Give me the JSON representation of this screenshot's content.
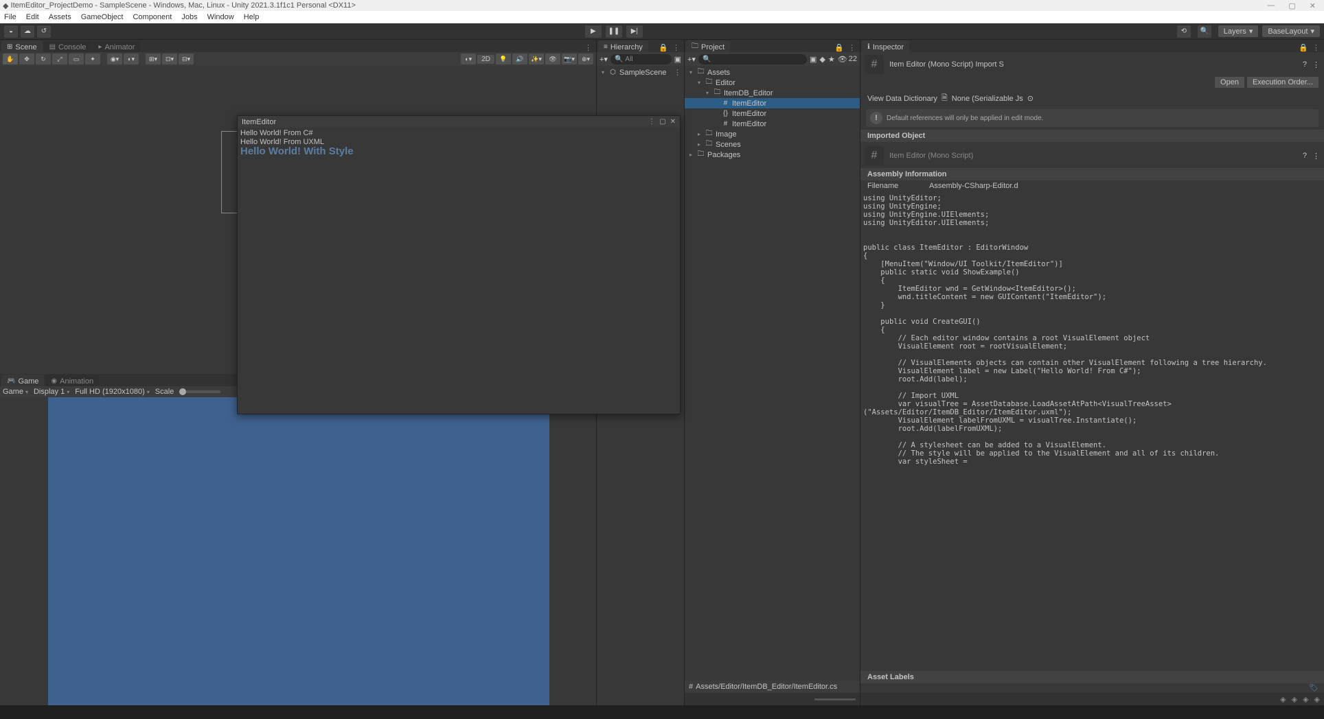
{
  "titlebar": {
    "text": "ItemEditor_ProjectDemo - SampleScene - Windows, Mac, Linux - Unity 2021.3.1f1c1 Personal <DX11>"
  },
  "menubar": [
    "File",
    "Edit",
    "Assets",
    "GameObject",
    "Component",
    "Jobs",
    "Window",
    "Help"
  ],
  "top_right": {
    "layers": "Layers",
    "layout": "BaseLayout"
  },
  "tabs": {
    "scene": "Scene",
    "console": "Console",
    "animator": "Animator",
    "game": "Game",
    "animation": "Animation",
    "hierarchy": "Hierarchy",
    "project": "Project",
    "inspector": "Inspector"
  },
  "scene_toolbar": {
    "mode2d": "2D"
  },
  "hierarchy": {
    "search_placeholder": "All",
    "root": "SampleScene"
  },
  "project": {
    "search_placeholder": "",
    "hidden_count": "22",
    "tree": [
      {
        "label": "Assets",
        "depth": 0,
        "icon": "▾",
        "type": "folder"
      },
      {
        "label": "Editor",
        "depth": 1,
        "icon": "▾",
        "type": "folder"
      },
      {
        "label": "ItemDB_Editor",
        "depth": 2,
        "icon": "▾",
        "type": "folder"
      },
      {
        "label": "ItemEditor",
        "depth": 3,
        "icon": "#",
        "type": "cs",
        "sel": true
      },
      {
        "label": "ItemEditor",
        "depth": 3,
        "icon": "{}",
        "type": "uss"
      },
      {
        "label": "ItemEditor",
        "depth": 3,
        "icon": "#",
        "type": "uxml"
      },
      {
        "label": "Image",
        "depth": 1,
        "icon": "▸",
        "type": "folder"
      },
      {
        "label": "Scenes",
        "depth": 1,
        "icon": "▸",
        "type": "folder"
      },
      {
        "label": "Packages",
        "depth": 0,
        "icon": "▸",
        "type": "folder"
      }
    ],
    "footer_path": "Assets/Editor/ItemDB_Editor/ItemEditor.cs"
  },
  "float_window": {
    "title": "ItemEditor",
    "line1": "Hello World! From C#",
    "line2": "Hello World! From UXML",
    "line3": "Hello World! With Style"
  },
  "game_toolbar": {
    "target": "Game",
    "display": "Display 1",
    "resolution": "Full HD (1920x1080)",
    "scale_label": "Scale"
  },
  "inspector": {
    "title": "Item Editor (Mono Script) Import S",
    "open_btn": "Open",
    "exec_btn": "Execution Order...",
    "view_dict": "View Data Dictionary",
    "ser_label": "None (Serializable Js",
    "warn": "Default references will only be applied in edit mode.",
    "imported": "Imported Object",
    "obj_title": "Item Editor (Mono Script)",
    "asm_header": "Assembly Information",
    "filename_k": "Filename",
    "filename_v": "Assembly-CSharp-Editor.d",
    "code": "using UnityEditor;\nusing UnityEngine;\nusing UnityEngine.UIElements;\nusing UnityEditor.UIElements;\n\n\npublic class ItemEditor : EditorWindow\n{\n    [MenuItem(\"Window/UI Toolkit/ItemEditor\")]\n    public static void ShowExample()\n    {\n        ItemEditor wnd = GetWindow<ItemEditor>();\n        wnd.titleContent = new GUIContent(\"ItemEditor\");\n    }\n\n    public void CreateGUI()\n    {\n        // Each editor window contains a root VisualElement object\n        VisualElement root = rootVisualElement;\n\n        // VisualElements objects can contain other VisualElement following a tree hierarchy.\n        VisualElement label = new Label(\"Hello World! From C#\");\n        root.Add(label);\n\n        // Import UXML\n        var visualTree = AssetDatabase.LoadAssetAtPath<VisualTreeAsset>(\"Assets/Editor/ItemDB_Editor/ItemEditor.uxml\");\n        VisualElement labelFromUXML = visualTree.Instantiate();\n        root.Add(labelFromUXML);\n\n        // A stylesheet can be added to a VisualElement.\n        // The style will be applied to the VisualElement and all of its children.\n        var styleSheet =",
    "asset_labels": "Asset Labels"
  }
}
